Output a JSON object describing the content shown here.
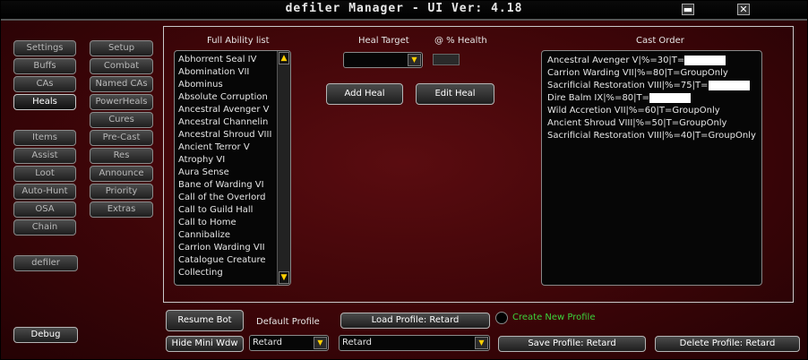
{
  "window": {
    "title": "defiler Manager  - UI Ver: 4.18",
    "minimize_glyph": "▬",
    "close_glyph": "✕"
  },
  "left_nav": {
    "col1": [
      "Settings",
      "Buffs",
      "CAs",
      "Heals",
      "Items",
      "Assist",
      "Loot",
      "Auto-Hunt",
      "OSA",
      "Chain"
    ],
    "col2": [
      "Setup",
      "Combat",
      "Named CAs",
      "PowerHeals",
      "Cures",
      "Pre-Cast",
      "Res",
      "Announce",
      "Priority",
      "Extras"
    ],
    "active": "Heals",
    "char_button": "defiler",
    "debug_button": "Debug"
  },
  "ability_list": {
    "header": "Full Ability list",
    "items": [
      "Abhorrent Seal IV",
      "Abomination VII",
      "Abominus",
      "Absolute Corruption",
      "Ancestral Avenger V",
      "Ancestral Channelin",
      "Ancestral Shroud VIII",
      "Ancient Terror V",
      "Atrophy VI",
      "Aura Sense",
      "Bane of Warding VI",
      "Call of the Overlord",
      "Call to Guild Hall",
      "Call to Home",
      "Cannibalize",
      "Carrion Warding VII",
      "Catalogue Creature",
      "Collecting"
    ]
  },
  "heal_target": {
    "label": "Heal Target",
    "value": ""
  },
  "health_pct": {
    "label": "@ % Health",
    "value": ""
  },
  "buttons": {
    "add_heal": "Add Heal",
    "edit_heal": "Edit Heal"
  },
  "cast_order": {
    "header": "Cast Order",
    "items": [
      {
        "text": "Ancestral Avenger V|%=30|T=",
        "redacted": true
      },
      {
        "text": "Carrion Warding VII|%=80|T=GroupOnly",
        "redacted": false
      },
      {
        "text": "Sacrificial Restoration VIII|%=75|T=",
        "redacted": true
      },
      {
        "text": "Dire Balm IX|%=80|T=",
        "redacted": true
      },
      {
        "text": "Wild Accretion VII|%=60|T=GroupOnly",
        "redacted": false
      },
      {
        "text": "Ancient Shroud VIII|%=50|T=GroupOnly",
        "redacted": false
      },
      {
        "text": "Sacrificial Restoration VIII|%=40|T=GroupOnly",
        "redacted": false
      }
    ]
  },
  "bottom": {
    "resume_bot": "Resume Bot",
    "hide_mini_wdw": "Hide Mini Wdw",
    "default_profile_label": "Default Profile",
    "default_profile_value": "Retard",
    "load_profile": "Load Profile: Retard",
    "create_new_profile": "Create New Profile",
    "profile_select_value": "Retard",
    "save_profile": "Save Profile: Retard",
    "delete_profile": "Delete Profile: Retard"
  },
  "colors": {
    "accent_green": "#3cd23c",
    "text": "#e6e6e6",
    "scroll_arrow": "#ffd000"
  }
}
